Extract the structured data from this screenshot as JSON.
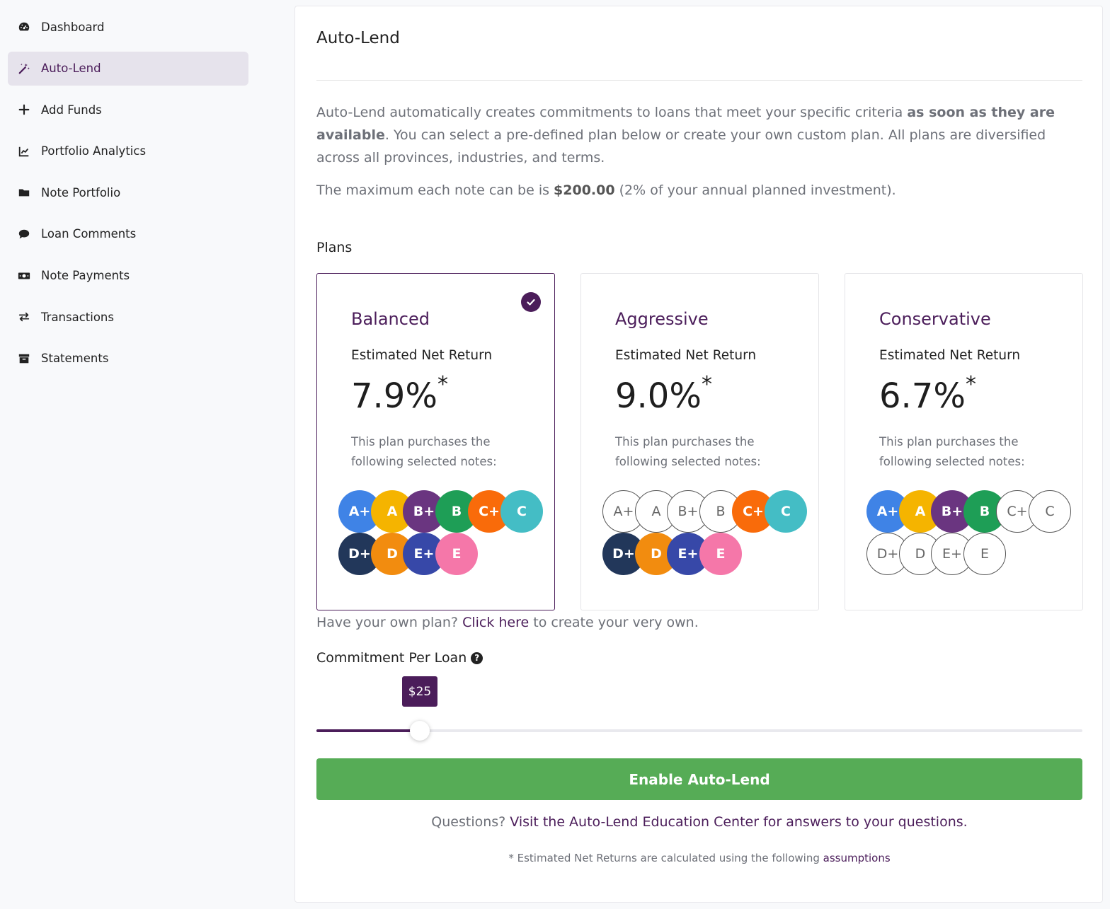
{
  "sidebar": {
    "items": [
      {
        "label": "Dashboard",
        "icon": "dashboard-icon",
        "active": false
      },
      {
        "label": "Auto-Lend",
        "icon": "magic-wand-icon",
        "active": true
      },
      {
        "label": "Add Funds",
        "icon": "plus-icon",
        "active": false
      },
      {
        "label": "Portfolio Analytics",
        "icon": "chart-line-icon",
        "active": false
      },
      {
        "label": "Note Portfolio",
        "icon": "folder-icon",
        "active": false
      },
      {
        "label": "Loan Comments",
        "icon": "comment-icon",
        "active": false
      },
      {
        "label": "Note Payments",
        "icon": "money-bill-icon",
        "active": false
      },
      {
        "label": "Transactions",
        "icon": "exchange-icon",
        "active": false
      },
      {
        "label": "Statements",
        "icon": "archive-icon",
        "active": false
      }
    ]
  },
  "main": {
    "title": "Auto-Lend",
    "intro_part1": "Auto-Lend automatically creates commitments to loans that meet your specific criteria ",
    "intro_bold": "as soon as they are available",
    "intro_part2": ". You can select a pre-defined plan below or create your own custom plan. All plans are diversified across all provinces, industries, and terms.",
    "max_prefix": "The maximum each note can be is ",
    "max_amount": "$200.00",
    "max_suffix": " (2% of your annual planned investment).",
    "plans_label": "Plans",
    "plans": [
      {
        "name": "Balanced",
        "return_label": "Estimated Net Return",
        "return_value": "7.9%",
        "asterisk": "*",
        "description": "This plan purchases the following selected notes:",
        "selected": true,
        "grades": [
          {
            "label": "A+",
            "on": true
          },
          {
            "label": "A",
            "on": true
          },
          {
            "label": "B+",
            "on": true
          },
          {
            "label": "B",
            "on": true
          },
          {
            "label": "C+",
            "on": true
          },
          {
            "label": "C",
            "on": true
          },
          {
            "label": "D+",
            "on": true
          },
          {
            "label": "D",
            "on": true
          },
          {
            "label": "E+",
            "on": true
          },
          {
            "label": "E",
            "on": true
          }
        ]
      },
      {
        "name": "Aggressive",
        "return_label": "Estimated Net Return",
        "return_value": "9.0%",
        "asterisk": "*",
        "description": "This plan purchases the following selected notes:",
        "selected": false,
        "grades": [
          {
            "label": "A+",
            "on": false
          },
          {
            "label": "A",
            "on": false
          },
          {
            "label": "B+",
            "on": false
          },
          {
            "label": "B",
            "on": false
          },
          {
            "label": "C+",
            "on": true
          },
          {
            "label": "C",
            "on": true
          },
          {
            "label": "D+",
            "on": true
          },
          {
            "label": "D",
            "on": true
          },
          {
            "label": "E+",
            "on": true
          },
          {
            "label": "E",
            "on": true
          }
        ]
      },
      {
        "name": "Conservative",
        "return_label": "Estimated Net Return",
        "return_value": "6.7%",
        "asterisk": "*",
        "description": "This plan purchases the following selected notes:",
        "selected": false,
        "grades": [
          {
            "label": "A+",
            "on": true
          },
          {
            "label": "A",
            "on": true
          },
          {
            "label": "B+",
            "on": true
          },
          {
            "label": "B",
            "on": true
          },
          {
            "label": "C+",
            "on": false
          },
          {
            "label": "C",
            "on": false
          },
          {
            "label": "D+",
            "on": false
          },
          {
            "label": "D",
            "on": false
          },
          {
            "label": "E+",
            "on": false
          },
          {
            "label": "E",
            "on": false
          }
        ]
      }
    ],
    "grade_colors": {
      "A+": "#3f83e6",
      "A": "#f5b400",
      "B+": "#6a3580",
      "B": "#1e9e56",
      "C+": "#f96b0a",
      "C": "#44bdc5",
      "D+": "#22375a",
      "D": "#f28c0f",
      "E+": "#3748a8",
      "E": "#f577a9"
    },
    "own_plan_prefix": "Have your own plan? ",
    "own_plan_link": "Click here",
    "own_plan_suffix": " to create your very own.",
    "commitment_label": "Commitment Per Loan",
    "slider": {
      "value_label": "$25",
      "fraction": 0.135
    },
    "enable_button": "Enable Auto-Lend",
    "questions_prefix": "Questions? ",
    "questions_link": "Visit the Auto-Lend Education Center for answers to your questions.",
    "footnote_prefix": "* Estimated Net Returns are calculated using the following ",
    "footnote_link": "assumptions"
  },
  "colors": {
    "accent": "#4b1d5a",
    "success": "#56ac56",
    "active_bg": "#e6e3ec"
  }
}
